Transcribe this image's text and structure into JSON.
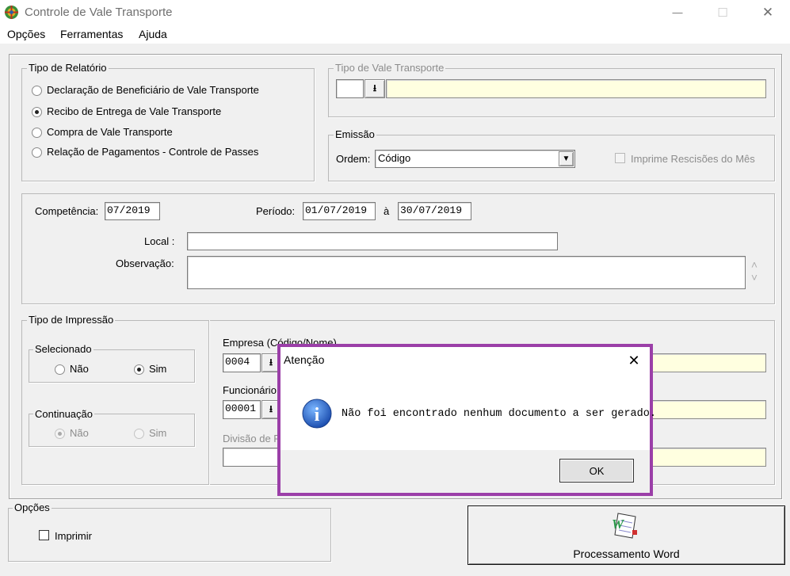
{
  "window": {
    "title": "Controle de Vale Transporte",
    "minimize_glyph": "—",
    "maximize_glyph": "☐",
    "close_glyph": "✕"
  },
  "menu": [
    "Opções",
    "Ferramentas",
    "Ajuda"
  ],
  "tipo_relatorio": {
    "legend": "Tipo de Relatório",
    "options": [
      "Declaração de Beneficiário de Vale Transporte",
      "Recibo de Entrega de Vale Transporte",
      "Compra de Vale Transporte",
      "Relação de Pagamentos - Controle de Passes"
    ],
    "selected_index": 1
  },
  "tipo_vale": {
    "legend": "Tipo de Vale Transporte",
    "code": "",
    "name": "",
    "lookup_glyph": "⭳"
  },
  "emissao": {
    "legend": "Emissão",
    "ordem_label": "Ordem:",
    "ordem_value": "Código",
    "dropdown_glyph": "▼",
    "imprime_rescisoes_label": "Imprime Rescisões do Mês",
    "imprime_rescisoes_checked": false
  },
  "datas": {
    "competencia_label": "Competência:",
    "competencia_value": "07/2019",
    "periodo_label": "Período:",
    "periodo_inicio": "01/07/2019",
    "periodo_sep": "à",
    "periodo_fim": "30/07/2019",
    "local_label": "Local :",
    "local_value": "",
    "observacao_label": "Observação:",
    "observacao_value": "",
    "scroll_up_glyph": "˄",
    "scroll_down_glyph": "˅"
  },
  "tipo_impressao": {
    "legend": "Tipo de Impressão",
    "selecionado": {
      "legend": "Selecionado",
      "nao": "Não",
      "sim": "Sim",
      "selected": "sim"
    },
    "continuacao": {
      "legend": "Continuação",
      "nao": "Não",
      "sim": "Sim",
      "selected": "nao"
    }
  },
  "empresa": {
    "label": "Empresa (Código/Nome)",
    "code": "0004",
    "name": "",
    "funcionario_label": "Funcionário",
    "funcionario_code": "00001",
    "funcionario_name": "",
    "divisao_label": "Divisão de F",
    "divisao_value": ""
  },
  "opcoes": {
    "legend": "Opções",
    "imprimir_label": "Imprimir",
    "imprimir_checked": false
  },
  "word_button": {
    "label": "Processamento Word",
    "icon_letter": "W"
  },
  "dialog": {
    "title": "Atenção",
    "message": "Não foi encontrado nenhum documento a ser gerado.",
    "ok_label": "OK",
    "info_glyph": "i",
    "close_glyph": "✕",
    "highlight_color": "#9b3fa8"
  }
}
